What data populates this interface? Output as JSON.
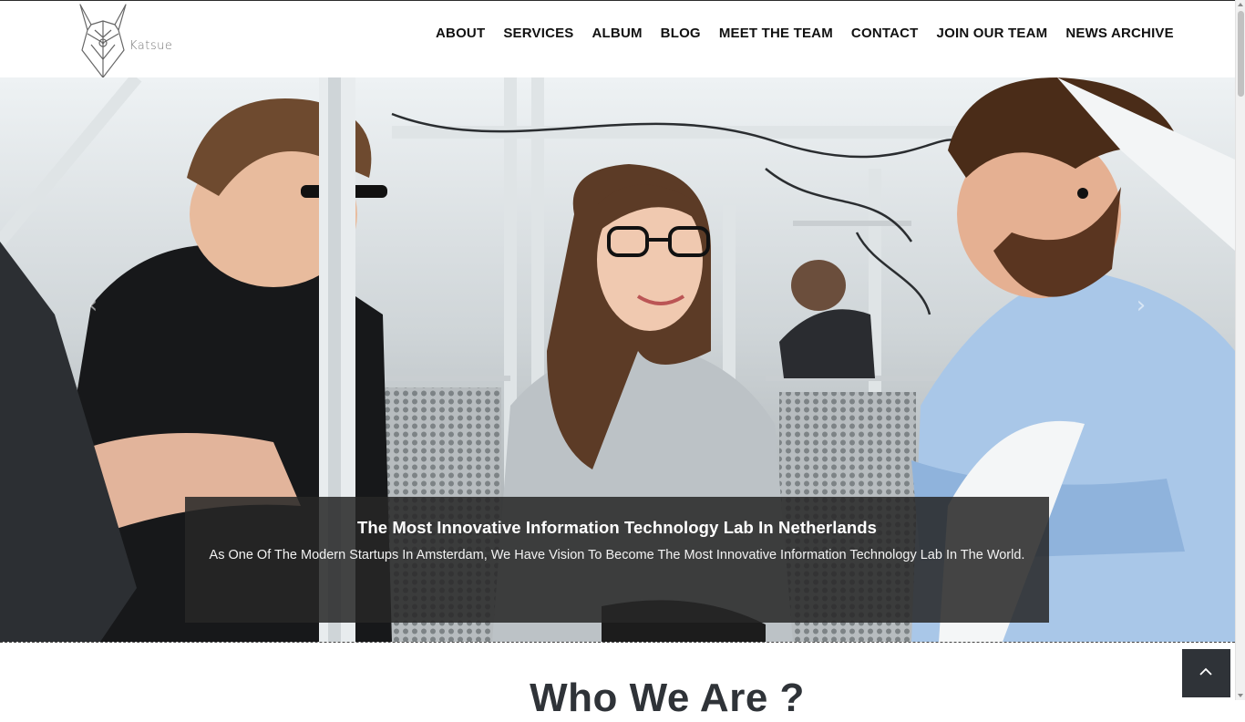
{
  "header": {
    "logo_text": "Katsue",
    "nav": [
      "ABOUT",
      "SERVICES",
      "ALBUM",
      "BLOG",
      "MEET THE TEAM",
      "CONTACT",
      "JOIN OUR TEAM",
      "NEWS ARCHIVE"
    ]
  },
  "hero": {
    "caption_title": "The Most Innovative Information Technology Lab In Netherlands",
    "caption_text": "As One Of The Modern Startups In Amsterdam, We Have Vision To Become The Most Innovative Information Technology Lab In The World.",
    "prev_icon": "chevron-left-icon",
    "next_icon": "chevron-right-icon"
  },
  "section": {
    "title": "Who We Are ?"
  },
  "back_to_top_icon": "chevron-up-icon",
  "colors": {
    "nav_text": "#111111",
    "caption_bg": "#262626",
    "title_text": "#2f3338",
    "back_to_top_bg": "#2f3338"
  }
}
